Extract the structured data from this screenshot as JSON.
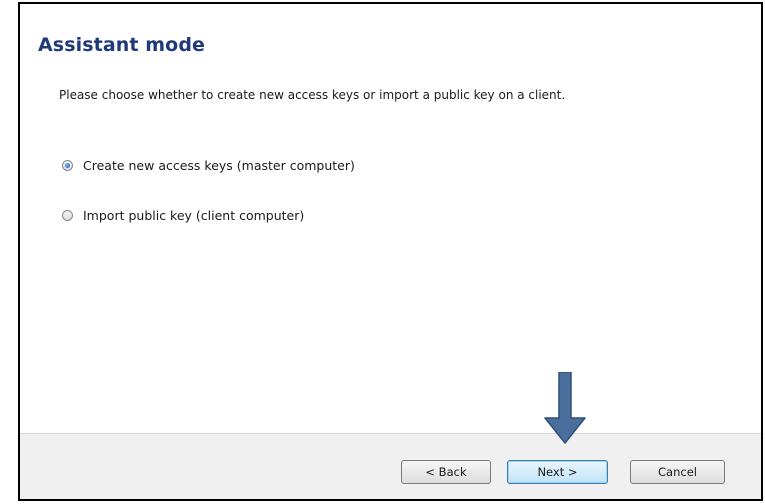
{
  "dialog": {
    "title": "Assistant mode",
    "instruction": "Please choose whether to create new access keys or import a public key on a client.",
    "options": [
      {
        "label": "Create new access keys (master computer)",
        "selected": true
      },
      {
        "label": "Import public key (client computer)",
        "selected": false
      }
    ]
  },
  "buttons": {
    "back_label": "< Back",
    "next_label": "Next >",
    "cancel_label": "Cancel"
  },
  "annotation": {
    "arrow_icon": "down-arrow-icon",
    "arrow_color": "#4a6f9c"
  },
  "colors": {
    "title": "#1f3a7a",
    "footer": "#f0f0f0"
  }
}
